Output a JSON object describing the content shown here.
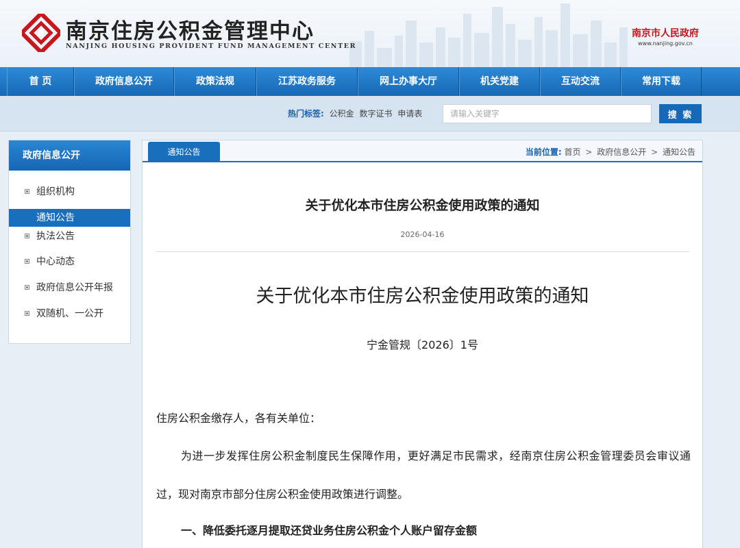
{
  "header": {
    "title": "南京住房公积金管理中心",
    "subtitle": "NANJING HOUSING PROVIDENT FUND MANAGEMENT CENTER",
    "gov_name": "南京市人民政府",
    "gov_url": "www.nanjing.gov.cn",
    "logo_icon": "diamond-logo-icon",
    "brand_color": "#c8161d"
  },
  "nav": {
    "items": [
      {
        "label": "首 页"
      },
      {
        "label": "政府信息公开"
      },
      {
        "label": "政策法规"
      },
      {
        "label": "江苏政务服务"
      },
      {
        "label": "网上办事大厅"
      },
      {
        "label": "机关党建"
      },
      {
        "label": "互动交流"
      },
      {
        "label": "常用下载"
      }
    ],
    "color": "#1669b7"
  },
  "search": {
    "hot_label": "热门标签:",
    "hot_tags": [
      "公积金",
      "数字证书",
      "申请表"
    ],
    "placeholder": "请输入关键字",
    "button_label": "搜 索"
  },
  "sidebar": {
    "title": "政府信息公开",
    "items": [
      {
        "label": "组织机构"
      },
      {
        "label": "通知公告",
        "active": true
      },
      {
        "label": "执法公告"
      },
      {
        "label": "中心动态"
      },
      {
        "label": "政府信息公开年报"
      },
      {
        "label": "双随机、一公开"
      }
    ]
  },
  "main": {
    "tab_label": "通知公告",
    "breadcrumb": {
      "label": "当前位置:",
      "items": [
        "首页",
        "政府信息公开",
        "通知公告"
      ],
      "separator": ">"
    },
    "article": {
      "title": "关于优化本市住房公积金使用政策的通知",
      "date": "2026-04-16",
      "doc_title": "关于优化本市住房公积金使用政策的通知",
      "doc_number": "宁金管规〔2026〕1号",
      "paragraphs": [
        "住房公积金缴存人，各有关单位：",
        "为进一步发挥住房公积金制度民生保障作用，更好满足市民需求，经南京住房公积金管理委员会审议通过，现对南京市部分住房公积金使用政策进行调整。",
        "一、降低委托逐月提取还贷业务住房公积金个人账户留存金额"
      ]
    }
  }
}
